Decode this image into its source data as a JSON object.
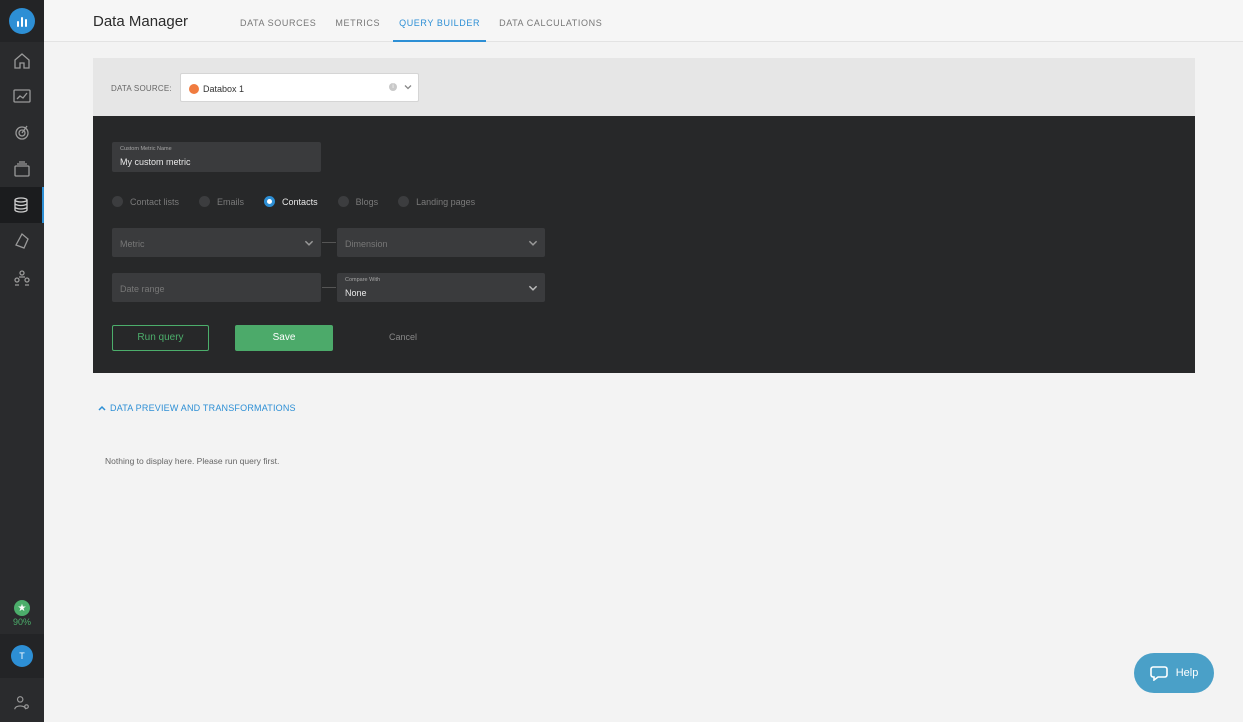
{
  "app": {
    "page_title": "Data Manager",
    "accent_color": "#2d8fd5",
    "success_color": "#4cae6b"
  },
  "tabs": [
    {
      "label": "DATA SOURCES",
      "active": false
    },
    {
      "label": "METRICS",
      "active": false
    },
    {
      "label": "QUERY BUILDER",
      "active": true
    },
    {
      "label": "DATA CALCULATIONS",
      "active": false
    }
  ],
  "sidebar": {
    "items": [
      {
        "icon": "home-icon"
      },
      {
        "icon": "dashboard-icon"
      },
      {
        "icon": "goals-icon"
      },
      {
        "icon": "scorecard-icon"
      },
      {
        "icon": "database-icon",
        "active": true
      },
      {
        "icon": "alerts-icon"
      },
      {
        "icon": "team-icon"
      }
    ],
    "progress_pct": "90%",
    "avatar_initial": "T"
  },
  "source": {
    "label": "DATA SOURCE:",
    "value": "Databox 1",
    "icon": "hubspot-icon"
  },
  "query": {
    "metric_name_label": "Custom Metric Name",
    "metric_name_value": "My custom metric",
    "radio_options": [
      {
        "label": "Contact lists",
        "checked": false
      },
      {
        "label": "Emails",
        "checked": false
      },
      {
        "label": "Contacts",
        "checked": true
      },
      {
        "label": "Blogs",
        "checked": false
      },
      {
        "label": "Landing pages",
        "checked": false
      }
    ],
    "metric_placeholder": "Metric",
    "dimension_placeholder": "Dimension",
    "date_range_placeholder": "Date range",
    "compare_label": "Compare With",
    "compare_value": "None",
    "run_label": "Run query",
    "save_label": "Save",
    "cancel_label": "Cancel"
  },
  "preview": {
    "toggle_label": "DATA PREVIEW AND TRANSFORMATIONS",
    "empty_message": "Nothing to display here. Please run query first."
  },
  "help": {
    "label": "Help"
  }
}
